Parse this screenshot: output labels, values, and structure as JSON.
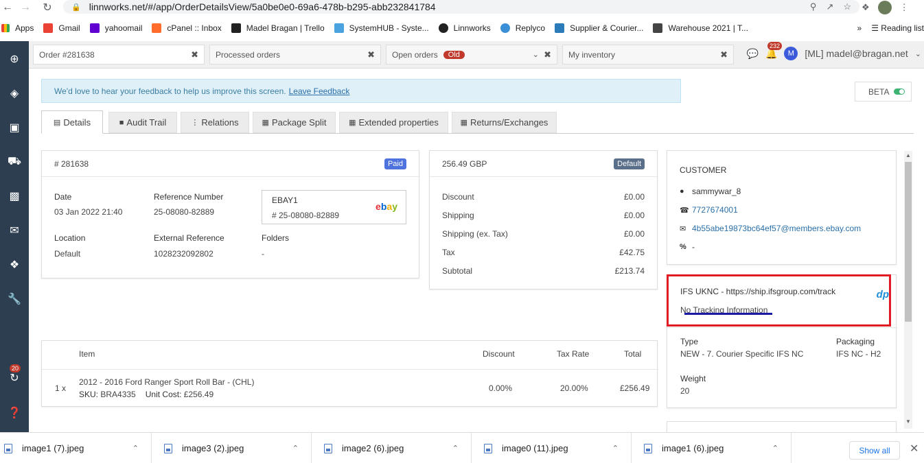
{
  "browser": {
    "url": "linnworks.net/#/app/OrderDetailsView/5a0be0e0-69a6-478b-b295-abb232841784",
    "bookmarks": [
      "Apps",
      "Gmail",
      "yahoomail",
      "cPanel :: Inbox",
      "Madel Bragan | Trello",
      "SystemHUB - Syste...",
      "Linnworks",
      "Replyco",
      "Supplier & Courier...",
      "Warehouse 2021 | T..."
    ],
    "more": "»",
    "reading_list": "Reading list"
  },
  "sidebar": {
    "badge": "20"
  },
  "app_tabs": [
    {
      "label": "Order #281638"
    },
    {
      "label": "Processed orders"
    },
    {
      "label": "Open orders",
      "badge": "Old"
    },
    {
      "label": "My inventory"
    }
  ],
  "topbar": {
    "notifications": "232",
    "user_initial": "M",
    "user": "[ML] madel@bragan.net"
  },
  "feedback": {
    "text": "We'd love to hear your feedback to help us improve this screen.",
    "link": "Leave Feedback"
  },
  "beta_label": "BETA",
  "sub_tabs": [
    "Details",
    "Audit Trail",
    "Relations",
    "Package Split",
    "Extended properties",
    "Returns/Exchanges"
  ],
  "order": {
    "number": "# 281638",
    "status": "Paid",
    "date_label": "Date",
    "date": "03 Jan 2022 21:40",
    "ref_label": "Reference Number",
    "ref": "25-08080-82889",
    "source": "EBAY1",
    "source_ref": "# 25-08080-82889",
    "source_logo": "ebay",
    "location_label": "Location",
    "location": "Default",
    "ext_ref_label": "External Reference",
    "ext_ref": "1028232092802",
    "folders_label": "Folders",
    "folders": "-"
  },
  "totals": {
    "total": "256.49 GBP",
    "badge": "Default",
    "rows": [
      {
        "label": "Discount",
        "value": "£0.00"
      },
      {
        "label": "Shipping",
        "value": "£0.00"
      },
      {
        "label": "Shipping (ex. Tax)",
        "value": "£0.00"
      },
      {
        "label": "Tax",
        "value": "£42.75"
      },
      {
        "label": "Subtotal",
        "value": "£213.74"
      }
    ]
  },
  "customer": {
    "title": "CUSTOMER",
    "username": "sammywar_8",
    "phone": "7727674001",
    "email": "4b55abe19873bc64ef57@members.ebay.com",
    "percent": "-"
  },
  "shipping": {
    "carrier": "IFS UKNC - https://ship.ifsgroup.com/track",
    "tracking": "No Tracking Information",
    "type_label": "Type",
    "type": "NEW - 7. Courier Specific IFS NC",
    "packaging_label": "Packaging",
    "packaging": "IFS NC - H2",
    "weight_label": "Weight",
    "weight": "20"
  },
  "items": {
    "headers": {
      "item": "Item",
      "discount": "Discount",
      "tax": "Tax Rate",
      "total": "Total"
    },
    "rows": [
      {
        "qty": "1 x",
        "title": "2012 - 2016 Ford Ranger Sport Roll Bar - (CHL)",
        "sku_label": "SKU:",
        "sku": "BRA4335",
        "cost_label": "Unit Cost:",
        "cost": "£256.49",
        "discount": "0.00%",
        "tax": "20.00%",
        "total": "£256.49"
      }
    ]
  },
  "downloads": [
    "image1 (7).jpeg",
    "image3 (2).jpeg",
    "image2 (6).jpeg",
    "image0 (11).jpeg",
    "image1 (6).jpeg"
  ],
  "show_all": "Show all"
}
